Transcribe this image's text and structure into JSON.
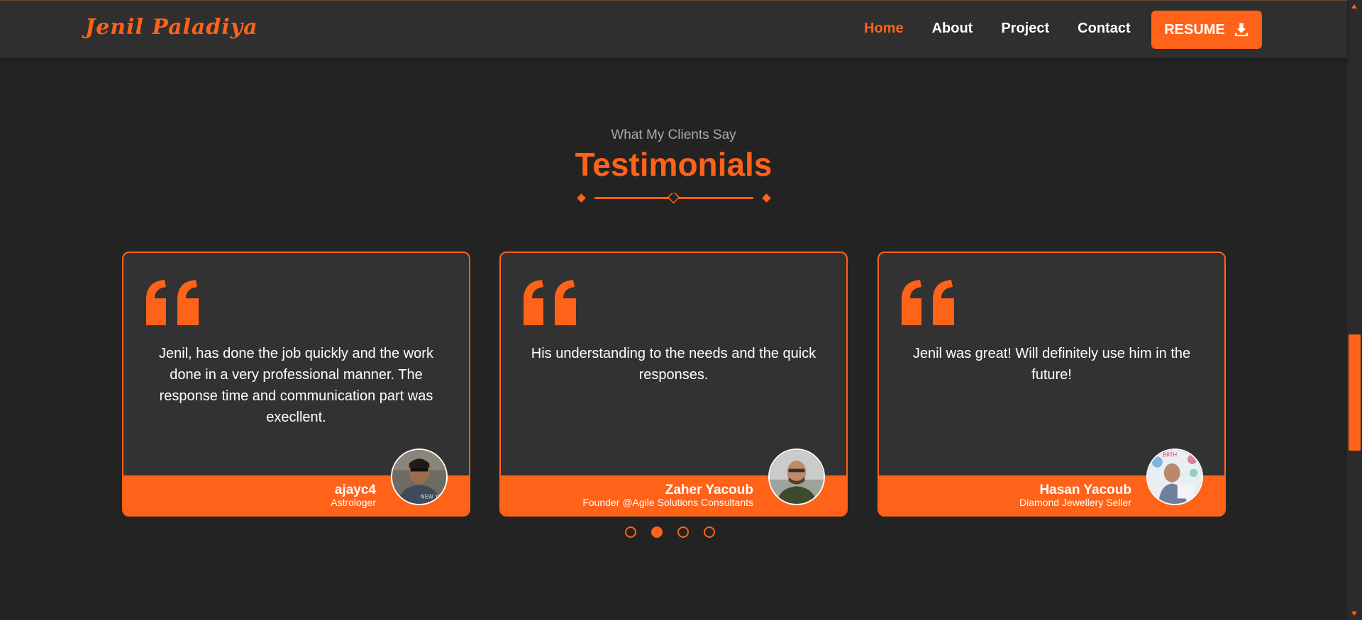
{
  "nav": {
    "brand": "Jenil Paladiya",
    "links": [
      {
        "label": "Home",
        "active": true
      },
      {
        "label": "About",
        "active": false
      },
      {
        "label": "Project",
        "active": false
      },
      {
        "label": "Contact",
        "active": false
      }
    ],
    "resume_label": "RESUME",
    "resume_icon": "download-icon"
  },
  "section": {
    "subtitle": "What My Clients Say",
    "title": "Testimonials"
  },
  "testimonials": [
    {
      "quote": "Jenil, has done the job quickly and the work done in a very professional manner. The response time and communication part was execllent.",
      "name": "ajayc4",
      "role": "Astrologer"
    },
    {
      "quote": "His understanding to the needs and the quick responses.",
      "name": "Zaher Yacoub",
      "role": "Founder @Agile Solutions Consultants"
    },
    {
      "quote": "Jenil was great! Will definitely use him in the future!",
      "name": "Hasan Yacoub",
      "role": "Diamond Jewellery Seller"
    }
  ],
  "carousel": {
    "dot_count": 4,
    "active_index": 1
  },
  "colors": {
    "accent": "#ff6219",
    "background": "#232323",
    "navbar": "#2f2f2f",
    "card": "#323232"
  }
}
